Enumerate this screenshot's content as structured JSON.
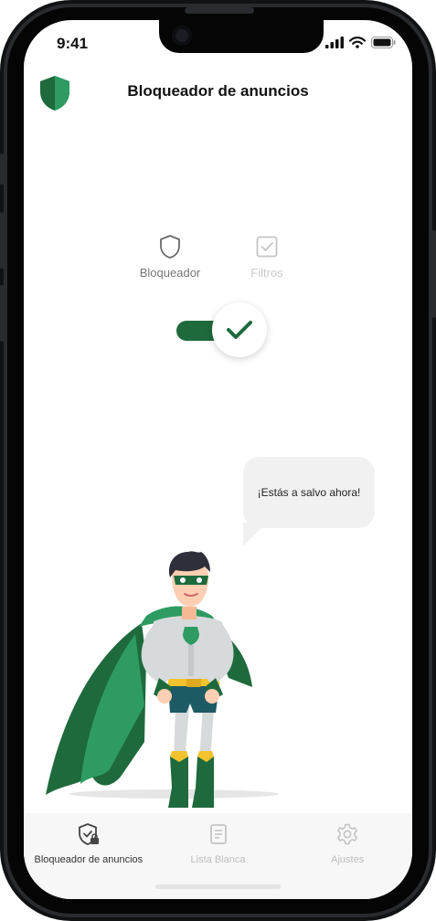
{
  "status_bar": {
    "time": "9:41"
  },
  "header": {
    "title": "Bloqueador de anuncios",
    "logo_icon": "shield-icon"
  },
  "modes": [
    {
      "label": "Bloqueador",
      "icon": "shield-outline-icon",
      "active": true
    },
    {
      "label": "Filtros",
      "icon": "checkbox-icon",
      "active": false
    }
  ],
  "toggle": {
    "on": true,
    "icon": "checkmark-icon"
  },
  "bubble": {
    "text": "¡Estás a salvo ahora!"
  },
  "tabs": [
    {
      "label": "Bloqueador de anuncios",
      "icon": "shield-lock-icon",
      "active": true
    },
    {
      "label": "Lista Blanca",
      "icon": "document-list-icon",
      "active": false
    },
    {
      "label": "Ajustes",
      "icon": "gear-icon",
      "active": false
    }
  ],
  "colors": {
    "brand": "#1e6a3d",
    "accent": "#2e9b62",
    "inactive": "#c9c9c9"
  }
}
